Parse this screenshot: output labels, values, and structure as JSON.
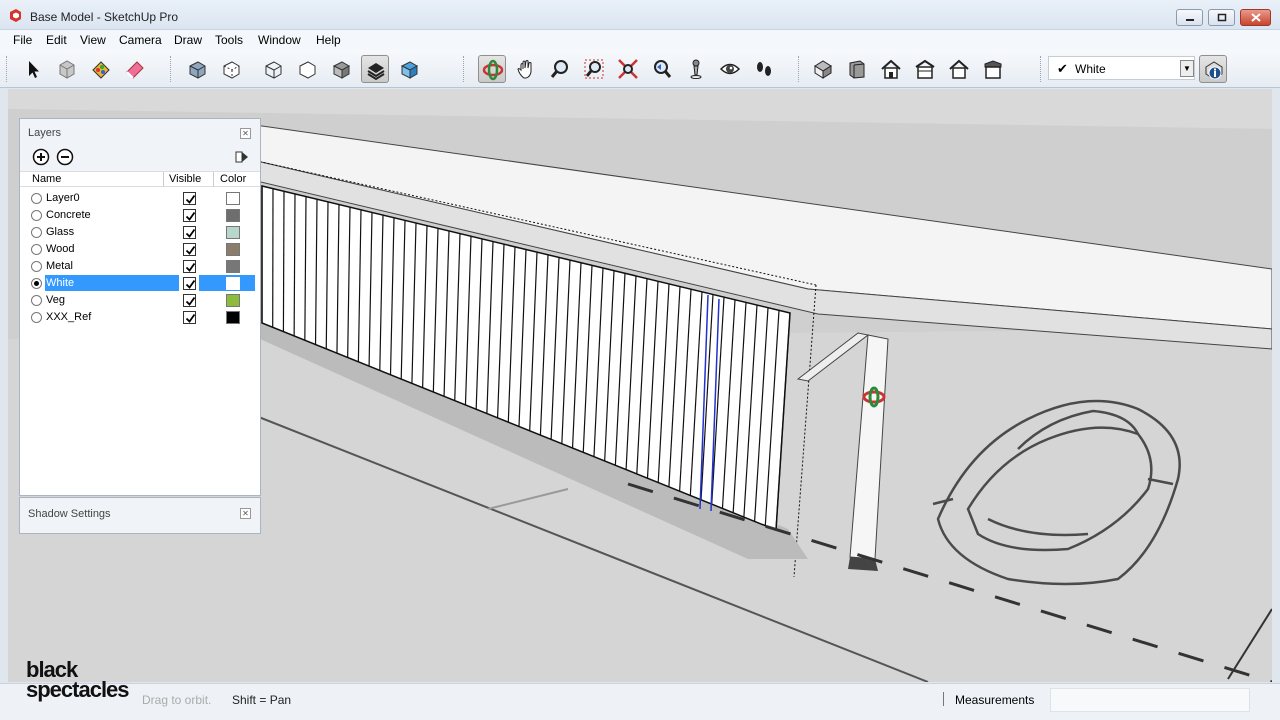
{
  "window": {
    "title": "Base Model - SketchUp Pro"
  },
  "menu": [
    "File",
    "Edit",
    "View",
    "Camera",
    "Draw",
    "Tools",
    "Window",
    "Help"
  ],
  "toolbar": {
    "tools": [
      "select-icon",
      "component-icon",
      "paint-bucket-icon",
      "eraser-icon",
      "xray-icon",
      "back-edges-icon",
      "wireframe-icon",
      "hidden-line-icon",
      "shaded-icon",
      "shaded-textures-icon",
      "monochrome-icon",
      "orbit-icon",
      "pan-icon",
      "zoom-icon",
      "zoom-window-icon",
      "zoom-extents-icon",
      "previous-view-icon",
      "position-camera-icon",
      "look-around-icon",
      "walk-icon",
      "iso-view-icon",
      "top-view-icon",
      "front-view-icon",
      "right-view-icon",
      "back-view-icon",
      "left-view-icon",
      "style-info-icon"
    ],
    "style_select": {
      "checked": true,
      "value": "White"
    }
  },
  "layers": {
    "title": "Layers",
    "columns": {
      "name": "Name",
      "visible": "Visible",
      "color": "Color"
    },
    "rows": [
      {
        "name": "Layer0",
        "active": false,
        "visible": true,
        "color": "#ffffff",
        "selected": false
      },
      {
        "name": "Concrete",
        "active": false,
        "visible": true,
        "color": "#6e6e6e",
        "selected": false
      },
      {
        "name": "Glass",
        "active": false,
        "visible": true,
        "color": "#b9d6cc",
        "selected": false
      },
      {
        "name": "Wood",
        "active": false,
        "visible": true,
        "color": "#8a7d6c",
        "selected": false
      },
      {
        "name": "Metal",
        "active": false,
        "visible": true,
        "color": "#777777",
        "selected": false
      },
      {
        "name": "White",
        "active": true,
        "visible": true,
        "color": "#ffffff",
        "selected": true
      },
      {
        "name": "Veg",
        "active": false,
        "visible": true,
        "color": "#8dbb3e",
        "selected": false
      },
      {
        "name": "XXX_Ref",
        "active": false,
        "visible": true,
        "color": "#000000",
        "selected": false
      }
    ]
  },
  "shadow_settings": {
    "title": "Shadow Settings"
  },
  "status": {
    "hint": "Drag to orbit.",
    "shift": "Shift = Pan",
    "measurements_label": "Measurements",
    "measurements_value": ""
  },
  "watermark": {
    "line1": "black",
    "line2": "spectacles"
  },
  "colors": {
    "selection": "#3399ff",
    "titlebar": "#dbe5f1"
  }
}
